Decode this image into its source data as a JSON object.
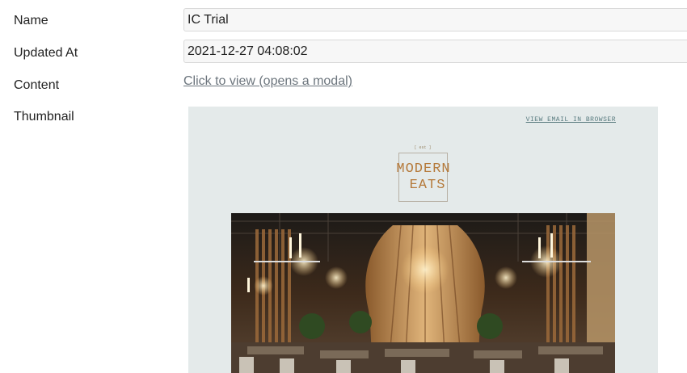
{
  "fields": {
    "name_label": "Name",
    "name_value": "IC Trial",
    "updated_label": "Updated At",
    "updated_value": "2021-12-27 04:08:02",
    "content_label": "Content",
    "content_link": "Click to view (opens a modal)",
    "thumbnail_label": "Thumbnail"
  },
  "thumbnail": {
    "view_in_browser": "VIEW EMAIL IN BROWSER",
    "est_text": "[ est ]",
    "logo_line1": "MODERN",
    "logo_line2": "EATS"
  }
}
